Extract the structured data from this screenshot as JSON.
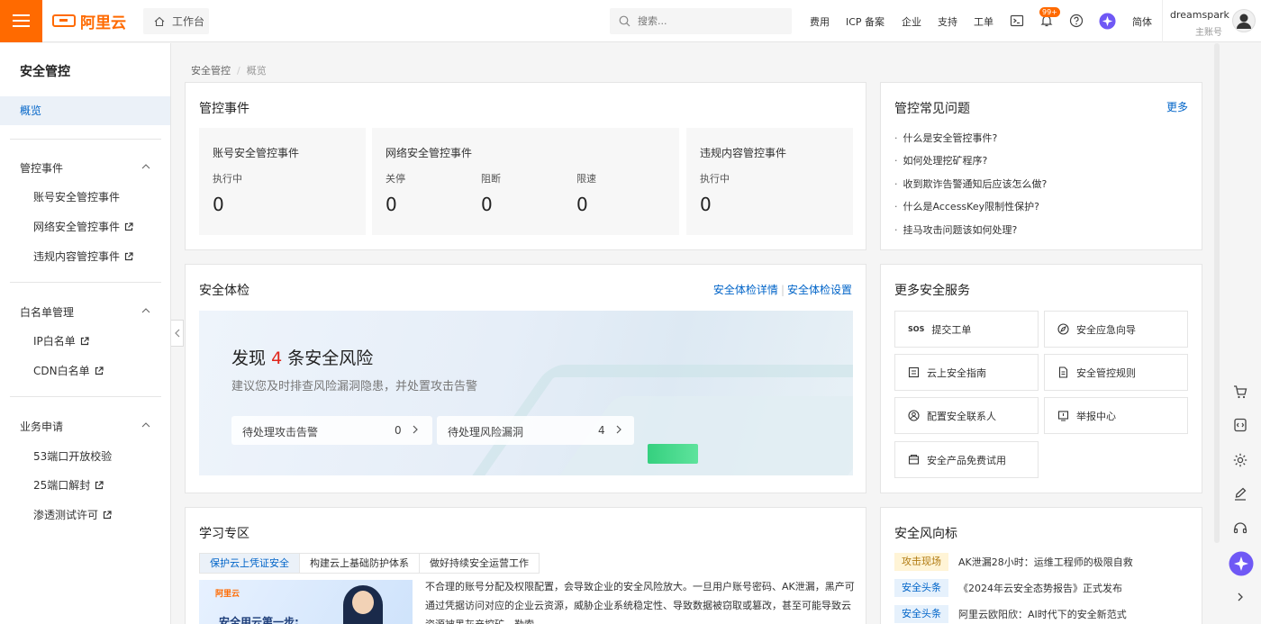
{
  "topbar": {
    "logo_text": "阿里云",
    "workbench": "工作台",
    "search_placeholder": "搜索...",
    "links": [
      "费用",
      "ICP 备案",
      "企业",
      "支持",
      "工单"
    ],
    "notification_count": "99+",
    "language": "简体",
    "user_name": "dreamspark",
    "user_role": "主账号",
    "accent_color": "#ff6a00"
  },
  "sidebar": {
    "title": "安全管控",
    "active_item": "概览",
    "groups": [
      {
        "label": "管控事件",
        "items": [
          "账号安全管控事件",
          "网络安全管控事件",
          "违规内容管控事件"
        ]
      },
      {
        "label": "白名单管理",
        "items": [
          "IP白名单",
          "CDN白名单"
        ]
      },
      {
        "label": "业务申请",
        "items": [
          "53端口开放校验",
          "25端口解封",
          "渗透测试许可"
        ]
      }
    ]
  },
  "breadcrumb": [
    "安全管控",
    "概览"
  ],
  "events": {
    "title": "管控事件",
    "account": {
      "title": "账号安全管控事件",
      "label": "执行中",
      "value": "0"
    },
    "network": {
      "title": "网络安全管控事件",
      "labels": [
        "关停",
        "阻断",
        "限速"
      ],
      "values": [
        "0",
        "0",
        "0"
      ]
    },
    "content": {
      "title": "违规内容管控事件",
      "label": "执行中",
      "value": "0"
    }
  },
  "faq": {
    "title": "管控常见问题",
    "more": "更多",
    "items": [
      "什么是安全管控事件?",
      "如何处理挖矿程序?",
      "收到欺诈告警通知后应该怎么做?",
      "什么是AccessKey限制性保护?",
      "挂马攻击问题该如何处理?"
    ]
  },
  "health_check": {
    "title": "安全体检",
    "link_details": "安全体检详情",
    "link_settings": "安全体检设置",
    "headline_prefix": "发现",
    "risk_count": "4",
    "headline_suffix": "条安全风险",
    "subtitle": "建议您及时排查风险漏洞隐患，并处置攻击告警",
    "pending_alerts_label": "待处理攻击告警",
    "pending_alerts_value": "0",
    "pending_vulns_label": "待处理风险漏洞",
    "pending_vulns_value": "4"
  },
  "services": {
    "title": "更多安全服务",
    "items": [
      "提交工单",
      "安全应急向导",
      "云上安全指南",
      "安全管控规则",
      "配置安全联系人",
      "举报中心",
      "安全产品免费试用"
    ]
  },
  "learning": {
    "title": "学习专区",
    "tabs": [
      "保护云上凭证安全",
      "构建云上基础防护体系",
      "做好持续安全运营工作"
    ],
    "image_logo": "阿里云",
    "image_caption": "安全用云第一步:",
    "text": "不合理的账号分配及权限配置，会导致企业的安全风险放大。一旦用户账号密码、AK泄漏，黑产可通过凭据访问对应的企业云资源，威胁企业系统稳定性、导致数据被窃取或篡改，甚至可能导致云资源被黑灰产挖矿、勒索。"
  },
  "trends": {
    "title": "安全风向标",
    "items": [
      {
        "tag": "攻击现场",
        "text": "AK泄漏28小时：运维工程师的极限自救"
      },
      {
        "tag": "安全头条",
        "text": "《2024年云安全态势报告》正式发布"
      },
      {
        "tag": "安全头条",
        "text": "阿里云欧阳欣：AI时代下的安全新范式"
      }
    ]
  }
}
